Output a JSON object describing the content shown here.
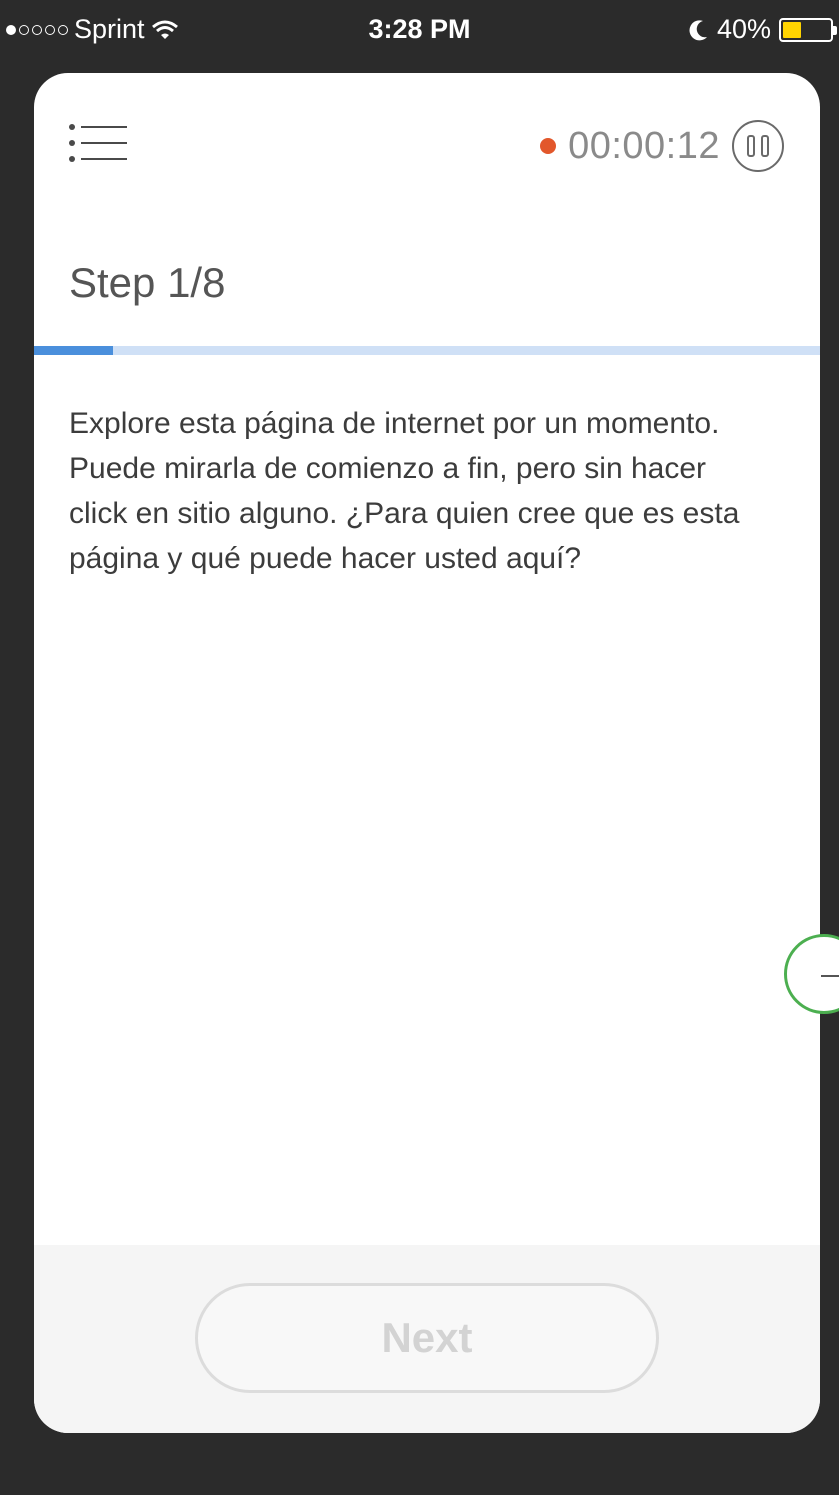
{
  "status_bar": {
    "carrier": "Sprint",
    "time": "3:28 PM",
    "battery_percent": "40%",
    "signal_bars": 1,
    "icons": [
      "wifi-icon",
      "moon-icon",
      "battery-icon"
    ],
    "battery_level": 0.4,
    "battery_color": "#ffd400"
  },
  "header": {
    "menu_icon": "list-menu-icon",
    "recording_color": "#e2572b",
    "timer": "00:00:12",
    "pause_icon": "pause-icon"
  },
  "task": {
    "step_label": "Step 1/8",
    "progress_fraction": 0.1,
    "progress_color": "#4a8fdc",
    "instructions": "Explore esta página de internet por un momento. Puede mirarla de comienzo a fin, pero sin hacer click en sitio alguno. ¿Para quien cree que es esta página y qué puede hacer usted aquí?"
  },
  "footer": {
    "next_label": "Next"
  },
  "side_handle": {
    "icon": "minus-icon",
    "border_color": "#4caf50"
  }
}
